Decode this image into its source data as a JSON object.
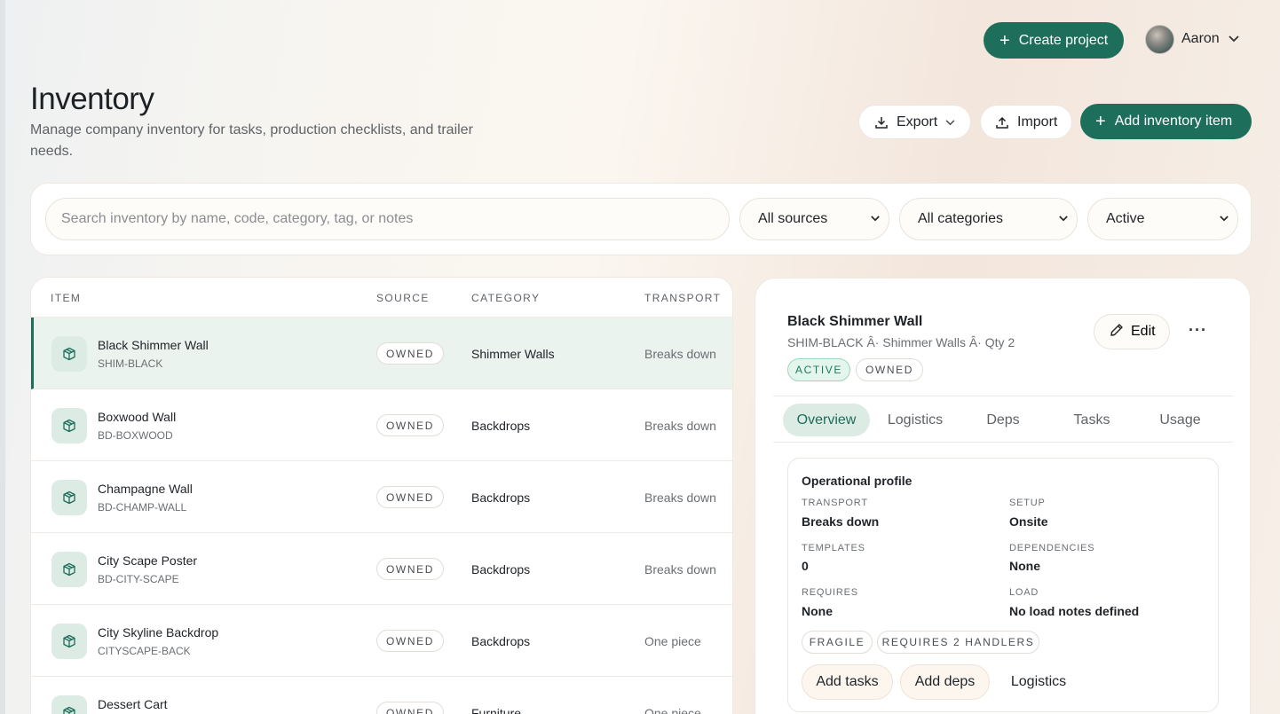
{
  "header": {
    "create_project_label": "Create project",
    "user_name": "Aaron"
  },
  "page": {
    "title": "Inventory",
    "subtitle": "Manage company inventory for tasks, production checklists, and trailer needs."
  },
  "actions": {
    "export_label": "Export",
    "import_label": "Import",
    "add_item_label": "Add inventory item"
  },
  "filters": {
    "search_placeholder": "Search inventory by name, code, category, tag, or notes",
    "source_value": "All sources",
    "category_value": "All categories",
    "status_value": "Active"
  },
  "table": {
    "columns": [
      "ITEM",
      "SOURCE",
      "CATEGORY",
      "TRANSPORT"
    ],
    "rows": [
      {
        "name": "Black Shimmer Wall",
        "code": "SHIM-BLACK",
        "source": "OWNED",
        "category": "Shimmer Walls",
        "transport": "Breaks down"
      },
      {
        "name": "Boxwood Wall",
        "code": "BD-BOXWOOD",
        "source": "OWNED",
        "category": "Backdrops",
        "transport": "Breaks down"
      },
      {
        "name": "Champagne Wall",
        "code": "BD-CHAMP-WALL",
        "source": "OWNED",
        "category": "Backdrops",
        "transport": "Breaks down"
      },
      {
        "name": "City Scape Poster",
        "code": "BD-CITY-SCAPE",
        "source": "OWNED",
        "category": "Backdrops",
        "transport": "Breaks down"
      },
      {
        "name": "City Skyline Backdrop",
        "code": "CITYSCAPE-BACK",
        "source": "OWNED",
        "category": "Backdrops",
        "transport": "One piece"
      },
      {
        "name": "Dessert Cart",
        "code": "",
        "source": "OWNED",
        "category": "Furniture",
        "transport": "One piece"
      }
    ]
  },
  "detail": {
    "title": "Black Shimmer Wall",
    "subtitle": "SHIM-BLACK Â· Shimmer Walls Â· Qty 2",
    "status_badge": "ACTIVE",
    "source_badge": "OWNED",
    "edit_label": "Edit",
    "more_label": "···",
    "tabs": [
      "Overview",
      "Logistics",
      "Deps",
      "Tasks",
      "Usage"
    ],
    "profile": {
      "title": "Operational profile",
      "transport_label": "TRANSPORT",
      "transport_value": "Breaks down",
      "setup_label": "SETUP",
      "setup_value": "Onsite",
      "templates_label": "TEMPLATES",
      "templates_value": "0",
      "dependencies_label": "DEPENDENCIES",
      "dependencies_value": "None",
      "requires_label": "REQUIRES",
      "requires_value": "None",
      "load_label": "LOAD",
      "load_value": "No load notes defined",
      "tags": [
        "FRAGILE",
        "REQUIRES 2 HANDLERS"
      ],
      "add_tasks_label": "Add tasks",
      "add_deps_label": "Add deps",
      "logistics_label": "Logistics"
    }
  },
  "colors": {
    "brand_green": "#1e6e5c",
    "selected_row_bg": "#eaf3ee",
    "active_badge_bg": "#e3f5ec"
  }
}
